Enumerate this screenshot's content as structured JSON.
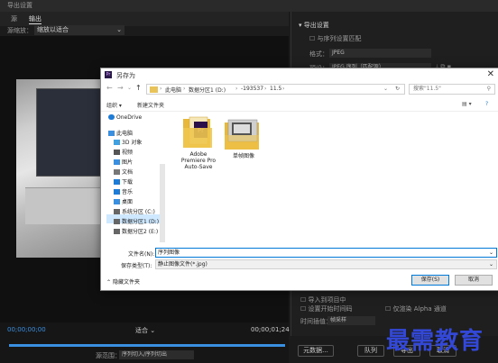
{
  "window": {
    "title": "导出设置"
  },
  "tabs": [
    "源",
    "输出"
  ],
  "source_scaling": {
    "label": "源缩放：",
    "value": "缩放以适合"
  },
  "right_panel": {
    "export_settings": "导出设置",
    "match_sequence": "与序列设置匹配",
    "format_label": "格式：",
    "format_value": "JPEG",
    "preset_label": "预设：",
    "preset_value": "JPEG 序列（匹配源）",
    "render_alpha": "仅渲染 Alpha 通道",
    "import_project": "导入到项目中",
    "set_start_timecode": "设置开始时间码",
    "time_interp_label": "时间插值：",
    "time_interp_value": "帧采样"
  },
  "timeline": {
    "tc_start": "00;00;00;00",
    "tc_end": "00;00;01;24",
    "fit": "适合",
    "range_label": "源范围：",
    "range_value": "序列切入/序列切出"
  },
  "bottom_buttons": {
    "metadata": "元数据...",
    "queue": "队列",
    "export": "导出",
    "cancel": "取消"
  },
  "watermark": "最需教育",
  "dialog": {
    "title": "另存为",
    "close_glyph": "✕",
    "path": [
      "此电脑",
      "数据分区1 (D:)",
      "-193537",
      "11.5"
    ],
    "search_placeholder": "搜索\"11.5\"",
    "organize": "组织 ▾",
    "new_folder": "新建文件夹",
    "sidebar": [
      {
        "label": "OneDrive",
        "icon": "cloud-icon",
        "color": "#1e7bd6"
      },
      {
        "label": "此电脑",
        "icon": "computer-icon",
        "color": "#3a8fe0"
      },
      {
        "label": "3D 对象",
        "icon": "cube-icon",
        "color": "#40a0e0"
      },
      {
        "label": "视频",
        "icon": "video-icon",
        "color": "#555555"
      },
      {
        "label": "图片",
        "icon": "picture-icon",
        "color": "#3a8fe0"
      },
      {
        "label": "文档",
        "icon": "document-icon",
        "color": "#777777"
      },
      {
        "label": "下载",
        "icon": "download-icon",
        "color": "#1e7bd6"
      },
      {
        "label": "音乐",
        "icon": "music-icon",
        "color": "#1e7bd6"
      },
      {
        "label": "桌面",
        "icon": "desktop-icon",
        "color": "#3a8fe0"
      },
      {
        "label": "系统分区 (C:)",
        "icon": "drive-icon",
        "color": "#666666"
      },
      {
        "label": "数据分区1 (D:)",
        "icon": "drive-icon",
        "color": "#666666"
      },
      {
        "label": "数据分区2 (E:)",
        "icon": "drive-icon",
        "color": "#666666"
      }
    ],
    "files": [
      {
        "line1": "Adobe",
        "line2": "Premiere Pro",
        "line3": "Auto-Save"
      },
      {
        "line1": "单帧图像"
      }
    ],
    "filename_label": "文件名(N):",
    "filename_value": "序列图像",
    "savetype_label": "保存类型(T):",
    "savetype_value": "静止图像文件(*.jpg)",
    "hide_folders": "隐藏文件夹",
    "save": "保存(S)",
    "cancel": "取消"
  }
}
